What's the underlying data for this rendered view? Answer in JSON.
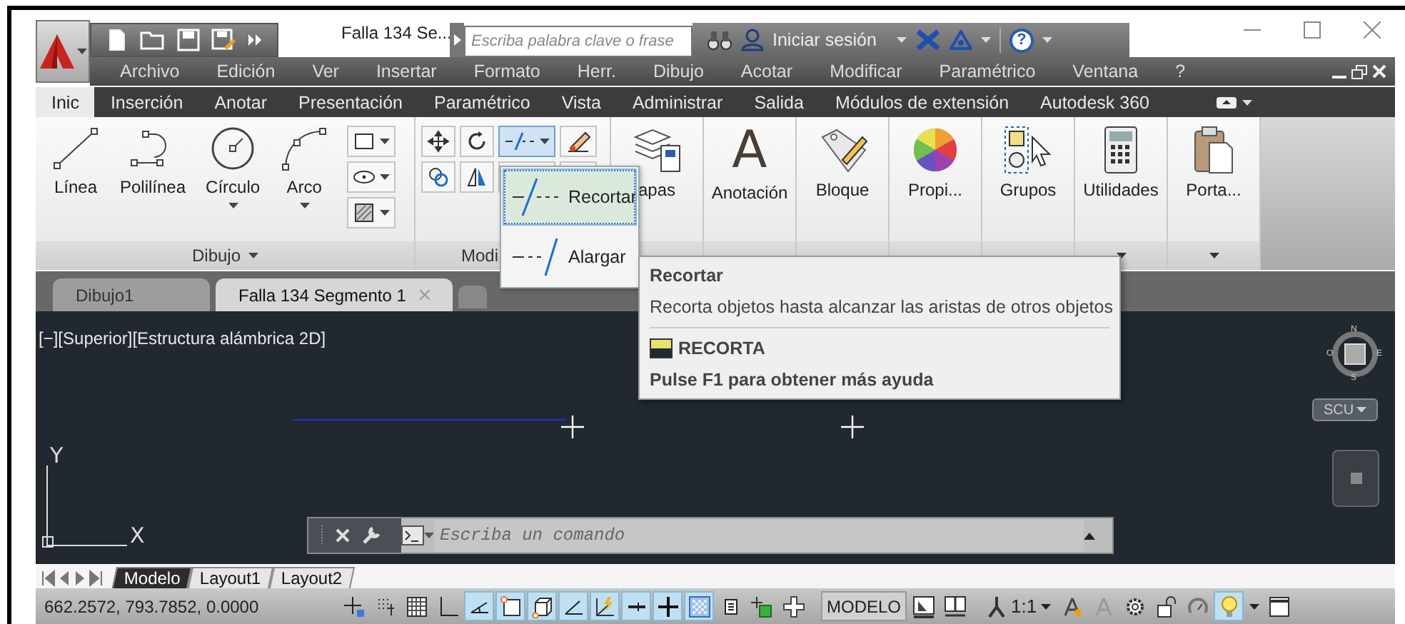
{
  "title_bar": {
    "title": "Falla 134 Se...",
    "search": {
      "placeholder": "Escriba palabra clave o frase"
    },
    "sign_in": "Iniciar sesión",
    "help": "?"
  },
  "menu_bar": [
    "Archivo",
    "Edición",
    "Ver",
    "Insertar",
    "Formato",
    "Herr.",
    "Dibujo",
    "Acotar",
    "Modificar",
    "Paramétrico",
    "Ventana",
    "?"
  ],
  "ribbon_tabs": [
    {
      "label": "Inic",
      "selected": true
    },
    {
      "label": "Inserción",
      "selected": false
    },
    {
      "label": "Anotar",
      "selected": false
    },
    {
      "label": "Presentación",
      "selected": false
    },
    {
      "label": "Paramétrico",
      "selected": false
    },
    {
      "label": "Vista",
      "selected": false
    },
    {
      "label": "Administrar",
      "selected": false
    },
    {
      "label": "Salida",
      "selected": false
    },
    {
      "label": "Módulos de extensión",
      "selected": false
    },
    {
      "label": "Autodesk 360",
      "selected": false
    }
  ],
  "ribbon": {
    "draw_tools": [
      {
        "label": "Línea",
        "dropdown": false
      },
      {
        "label": "Polilínea",
        "dropdown": false
      },
      {
        "label": "Círculo",
        "dropdown": true
      },
      {
        "label": "Arco",
        "dropdown": true
      }
    ],
    "draw_panel_label": "Dibujo",
    "modify_panel_label": "Modi",
    "panels": [
      {
        "label": "apas"
      },
      {
        "label": "Anotación",
        "icon_text": "A"
      },
      {
        "label": "Bloque"
      },
      {
        "label": "Propi..."
      },
      {
        "label": "Grupos"
      },
      {
        "label": "Utilidades",
        "dropdown": true
      },
      {
        "label": "Porta...",
        "dropdown": true
      }
    ]
  },
  "dropdown_menu": [
    {
      "label": "Recortar",
      "selected": true
    },
    {
      "label": "Alargar",
      "selected": false
    }
  ],
  "tooltip": {
    "title": "Recortar",
    "description": "Recorta objetos hasta alcanzar las aristas de otros objetos",
    "command": "RECORTA",
    "help": "Pulse F1 para obtener más ayuda"
  },
  "document_tabs": [
    {
      "label": "Dibujo1",
      "selected": false
    },
    {
      "label": "Falla 134 Segmento 1",
      "selected": true
    }
  ],
  "viewport": {
    "label": "[−][Superior][Estructura alámbrica 2D]",
    "compass": [
      "N",
      "O",
      "E",
      "S"
    ],
    "ucs_button": "SCU",
    "axis_y": "Y",
    "axis_x": "X"
  },
  "command_line": {
    "placeholder": "Escriba un comando"
  },
  "layout_tabs": [
    {
      "label": "Modelo",
      "selected": true
    },
    {
      "label": "Layout1",
      "selected": false
    },
    {
      "label": "Layout2",
      "selected": false
    }
  ],
  "status_bar": {
    "coordinates": "662.2572, 793.7852, 0.0000",
    "items": [
      {
        "kind": "toggle",
        "on": false
      },
      {
        "kind": "toggle",
        "on": false
      },
      {
        "kind": "toggle",
        "on": false
      },
      {
        "kind": "toggle",
        "on": false
      },
      {
        "kind": "toggle",
        "on": true
      },
      {
        "kind": "toggle",
        "on": true
      },
      {
        "kind": "toggle",
        "on": true
      },
      {
        "kind": "toggle",
        "on": true
      },
      {
        "kind": "toggle",
        "on": true
      },
      {
        "kind": "toggle",
        "on": true
      },
      {
        "kind": "toggle",
        "on": true
      },
      {
        "kind": "toggle",
        "on": true
      },
      {
        "kind": "toggle",
        "on": false
      },
      {
        "kind": "toggle",
        "on": false
      },
      {
        "kind": "toggle",
        "on": false
      },
      {
        "kind": "label",
        "text": "MODELO"
      },
      {
        "kind": "toggle",
        "on": false
      },
      {
        "kind": "toggle",
        "on": false
      },
      {
        "kind": "scale",
        "text": "1:1"
      },
      {
        "kind": "toggle",
        "on": false
      },
      {
        "kind": "toggle",
        "on": false
      },
      {
        "kind": "toggle",
        "on": false
      },
      {
        "kind": "toggle",
        "on": false
      },
      {
        "kind": "toggle",
        "on": false
      },
      {
        "kind": "toggle",
        "on": true
      },
      {
        "kind": "menu"
      },
      {
        "kind": "toggle",
        "on": false
      }
    ]
  }
}
